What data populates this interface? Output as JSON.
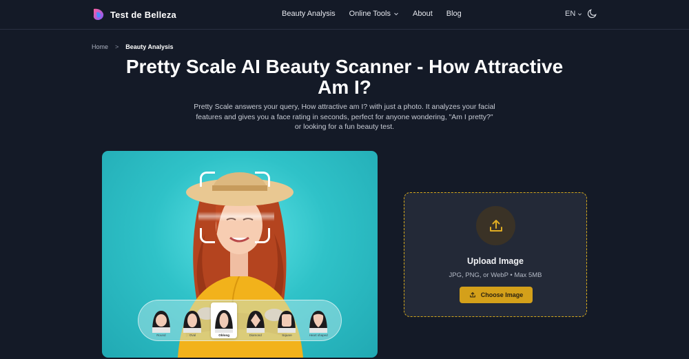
{
  "header": {
    "brand": "Test de Belleza",
    "nav": [
      {
        "label": "Beauty Analysis"
      },
      {
        "label": "Online Tools"
      },
      {
        "label": "About"
      },
      {
        "label": "Blog"
      }
    ],
    "language": "EN",
    "icons": {
      "logo": "brand-logo-icon",
      "theme": "moon-icon",
      "dropdown": "chevron-down-icon"
    }
  },
  "breadcrumb": {
    "home": "Home",
    "separator": ">",
    "current": "Beauty Analysis"
  },
  "hero": {
    "title": "Pretty Scale AI Beauty Scanner - How Attractive Am I?",
    "subtitle": "Pretty Scale answers your query, How attractive am I? with just a photo. It analyzes your facial features and gives you a face rating in seconds, perfect for anyone wondering, \"Am I pretty?\" or looking for a fun beauty test."
  },
  "face_shapes": {
    "items": [
      "Round",
      "Oval",
      "Oblong",
      "Diamond",
      "Square",
      "Heart shaped"
    ],
    "selected": "Oblong"
  },
  "upload": {
    "title": "Upload Image",
    "hint": "JPG, PNG, or WebP • Max 5MB",
    "button": "Choose Image",
    "icon": "upload-icon"
  },
  "colors": {
    "background": "#141a27",
    "accent": "#d4a01a",
    "panel": "#232937",
    "hero_bg": "#2fc2c8"
  }
}
